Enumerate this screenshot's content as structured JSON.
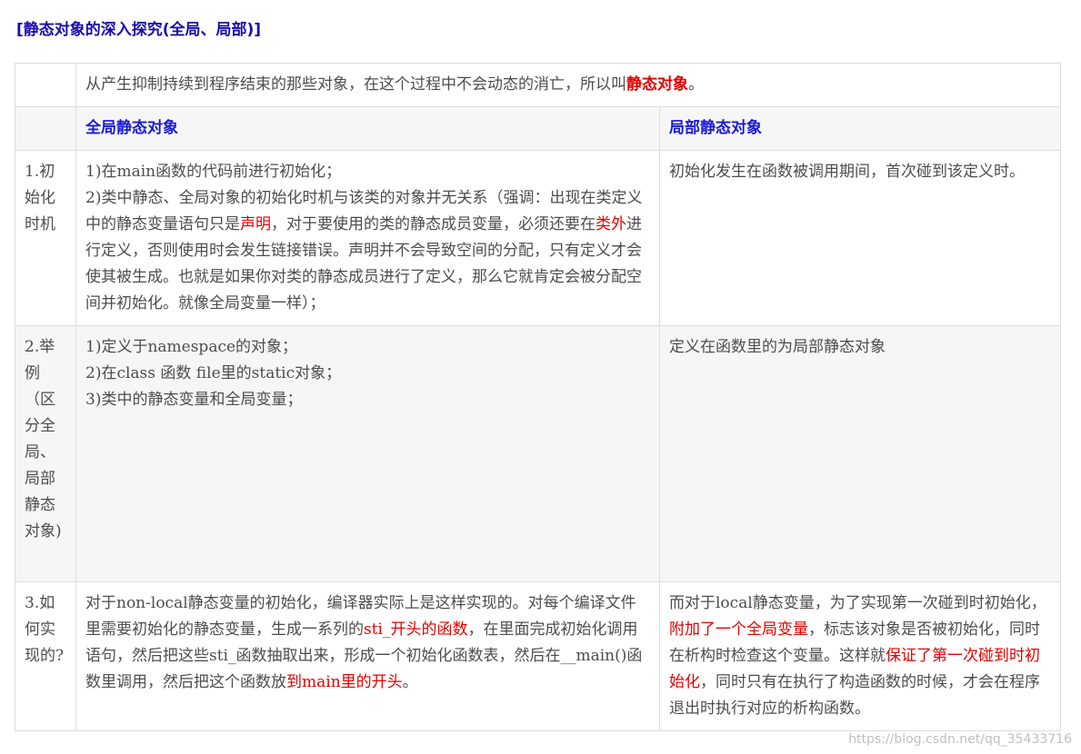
{
  "title": "[静态对象的深入探究(全局、局部)]",
  "intro": {
    "text": "从产生抑制持续到程序结束的那些对象，在这个过程中不会动态的消亡，所以叫",
    "highlight": "静态对象",
    "end": "。"
  },
  "headers": {
    "global": "全局静态对象",
    "local": "局部静态对象"
  },
  "rows": [
    {
      "label": "1.初始化时机",
      "global": {
        "p1": "1)在main函数的代码前进行初始化；",
        "p2a": "2)类中静态、全局对象的初始化时机与该类的对象并无关系（强调：出现在类定义中的静态变量语句只是",
        "p2r1": "声明",
        "p2b": "，对于要使用的类的静态成员变量，必须还要在",
        "p2r2": "类外",
        "p2c": "进行定义，否则使用时会发生链接错误。声明并不会导致空间的分配，只有定义才会使其被生成。也就是如果你对类的静态成员进行了定义，那么它就肯定会被分配空间并初始化。就像全局变量一样）；"
      },
      "local": "初始化发生在函数被调用期间，首次碰到该定义时。"
    },
    {
      "label": "2.举例（区分全局、局部静态对象)",
      "global": {
        "l1": "1)定义于namespace的对象；",
        "l2": "2)在class 函数 file里的static对象；",
        "l3": "3)类中的静态变量和全局变量；"
      },
      "local": "定义在函数里的为局部静态对象"
    },
    {
      "label": "3.如何实现的?",
      "global": {
        "a": "对于non-local静态变量的初始化，编译器实际上是这样实现的。对每个编译文件里需要初始化的静态变量，生成一系列的",
        "r1": "sti_开头的函数",
        "b": "，在里面完成初始化调用语句，然后把这些sti_函数抽取出来，形成一个初始化函数表，然后在__main()函数里调用，然后把这个函数放",
        "r2": "到main里的开头",
        "c": "。"
      },
      "local": {
        "a": "而对于local静态变量，为了实现第一次碰到时初始化，",
        "r1": "附加了一个全局变量",
        "b": "，标志该对象是否被初始化，同时在析构时检查这个变量。这样就",
        "r2": "保证了第一次碰到时初始化",
        "c": "，同时只有在执行了构造函数的时候，才会在程序退出时执行对应的析构函数。"
      }
    }
  ],
  "watermark": "https://blog.csdn.net/qq_35433716"
}
